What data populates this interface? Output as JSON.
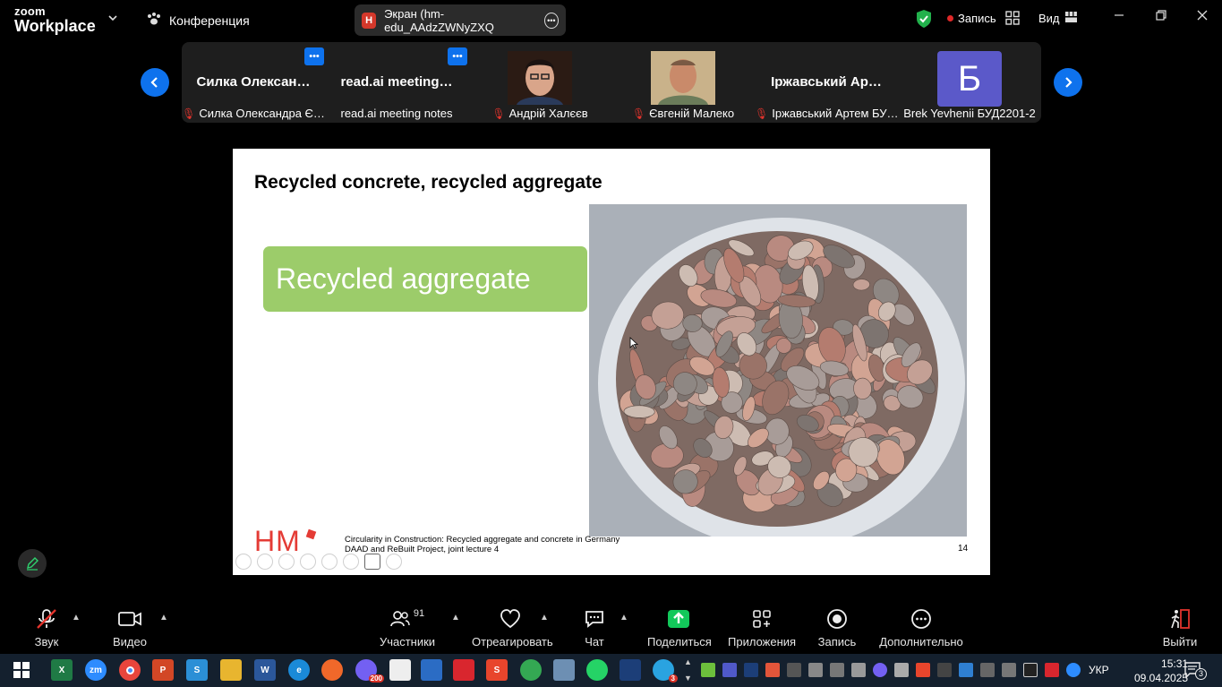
{
  "app": {
    "logo_line1": "zoom",
    "logo_line2": "Workplace",
    "meeting_label": "Конференция",
    "screen_share_badge": "H",
    "screen_share_title": "Экран (hm-edu_AAdzZWNyZXQ",
    "recording_label": "Запись",
    "view_label": "Вид"
  },
  "participants": [
    {
      "big_name": "Силка Олексан…",
      "label": "Силка Олександра Є…",
      "muted": true,
      "has_menu": true
    },
    {
      "big_name": "read.ai meeting…",
      "label": "read.ai meeting notes",
      "muted": false,
      "has_menu": true
    },
    {
      "big_name": "",
      "label": "Андрій Халєєв",
      "muted": true,
      "has_menu": false
    },
    {
      "big_name": "",
      "label": "Євгеній Малеко",
      "muted": true,
      "has_menu": false
    },
    {
      "big_name": "Іржавський Ар…",
      "label": "Іржавський Артем БУ…",
      "muted": true,
      "has_menu": false
    },
    {
      "big_name": "",
      "avatar_letter": "Б",
      "label": "Brek Yevhenii БУД2201-2",
      "muted": false,
      "has_menu": false
    }
  ],
  "slide": {
    "title": "Recycled concrete, recycled aggregate",
    "box_text": "Recycled aggregate",
    "logo_text": "HM",
    "footer_line1": "Circularity in Construction: Recycled aggregate and concrete in Germany",
    "footer_line2": "DAAD and ReBuilt Project, joint lecture 4",
    "page_number": "14"
  },
  "toolbar": {
    "audio": "Звук",
    "video": "Видео",
    "participants": "Участники",
    "participants_count": "91",
    "react": "Отреагировать",
    "chat": "Чат",
    "share": "Поделиться",
    "apps": "Приложения",
    "record": "Запись",
    "more": "Дополнительно",
    "leave": "Выйти"
  },
  "taskbar": {
    "viber_badge": "200",
    "telegram_badge": "3",
    "language": "УКР",
    "time": "15:31",
    "date": "09.04.2025",
    "notifications": "3"
  },
  "colors": {
    "zoom_blue": "#0e72ed",
    "recording_red": "#e02828",
    "slide_green": "#9ccc6a",
    "hm_red": "#e43b35",
    "share_green": "#12c85a"
  }
}
